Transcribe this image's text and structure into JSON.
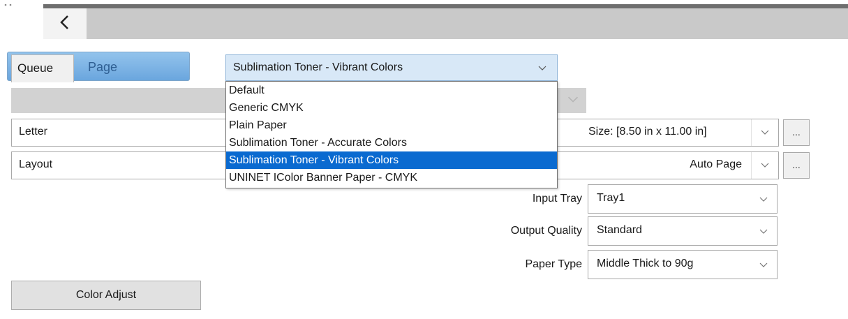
{
  "toolbar": {
    "back_icon": "chevron-left-icon"
  },
  "tabs": [
    {
      "label": "Queue",
      "active": true
    },
    {
      "label": "Page",
      "active": false
    }
  ],
  "profile_dropdown": {
    "selected": "Sublimation Toner - Vibrant Colors",
    "options": [
      "Default",
      "Generic CMYK",
      "Plain Paper",
      "Sublimation Toner - Accurate Colors",
      "Sublimation Toner - Vibrant Colors",
      "UNINET IColor Banner Paper - CMYK"
    ],
    "highlighted_index": 4
  },
  "paper_row": {
    "label": "Letter",
    "value": "Size: [8.50 in x 11.00 in]",
    "more_label": "..."
  },
  "layout_row": {
    "label": "Layout",
    "value": "Auto Page",
    "more_label": "..."
  },
  "fields": [
    {
      "label": "Input Tray",
      "value": "Tray1"
    },
    {
      "label": "Output Quality",
      "value": "Standard"
    },
    {
      "label": "Paper Type",
      "value": "Middle Thick to 90g"
    }
  ],
  "color_adjust_label": "Color Adjust",
  "colors": {
    "selection": "#0a6ad0",
    "tab_strip": "#7fb3e6",
    "combo_bg": "#d8e8f7"
  }
}
